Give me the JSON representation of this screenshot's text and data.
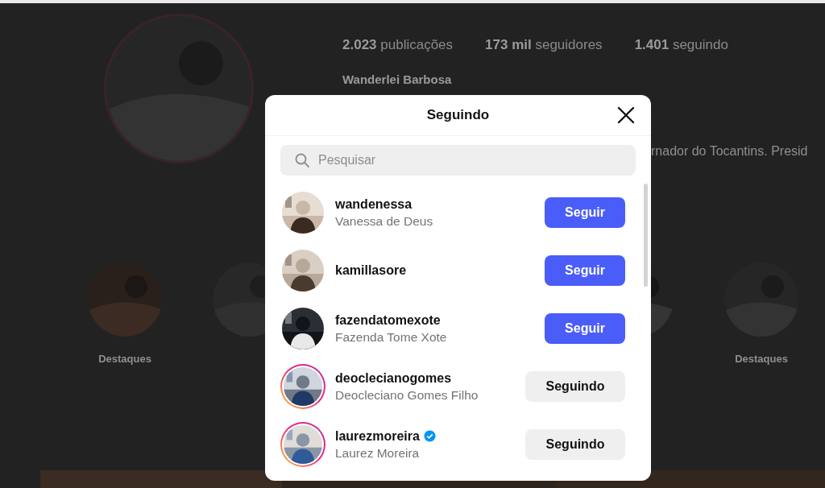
{
  "profile": {
    "stats": [
      {
        "count": "2.023",
        "label": "publicações"
      },
      {
        "count": "173 mil",
        "label": "seguidores"
      },
      {
        "count": "1.401",
        "label": "seguindo"
      }
    ],
    "name": "Wanderlei Barbosa",
    "bio": "rnador do Tocantins. Presid"
  },
  "highlights": [
    {
      "label": "Destaques"
    },
    {
      "label": "Destaques"
    }
  ],
  "modal": {
    "title": "Seguindo",
    "search": {
      "placeholder": "Pesquisar"
    },
    "users": [
      {
        "username": "wandenessa",
        "full_name": "Vanessa de Deus",
        "story_ring": false,
        "verified": false,
        "button": {
          "label": "Seguir",
          "kind": "follow"
        }
      },
      {
        "username": "kamillasore",
        "story_ring": false,
        "verified": false,
        "button": {
          "label": "Seguir",
          "kind": "follow"
        }
      },
      {
        "username": "fazendatomexote",
        "full_name": "Fazenda Tome Xote",
        "story_ring": false,
        "verified": false,
        "button": {
          "label": "Seguir",
          "kind": "follow"
        }
      },
      {
        "username": "deoclecianogomes",
        "full_name": "Deocleciano Gomes Filho",
        "story_ring": true,
        "verified": false,
        "button": {
          "label": "Seguindo",
          "kind": "following"
        }
      },
      {
        "username": "laurezmoreira",
        "full_name": "Laurez Moreira",
        "story_ring": true,
        "verified": true,
        "button": {
          "label": "Seguindo",
          "kind": "following"
        }
      }
    ]
  }
}
